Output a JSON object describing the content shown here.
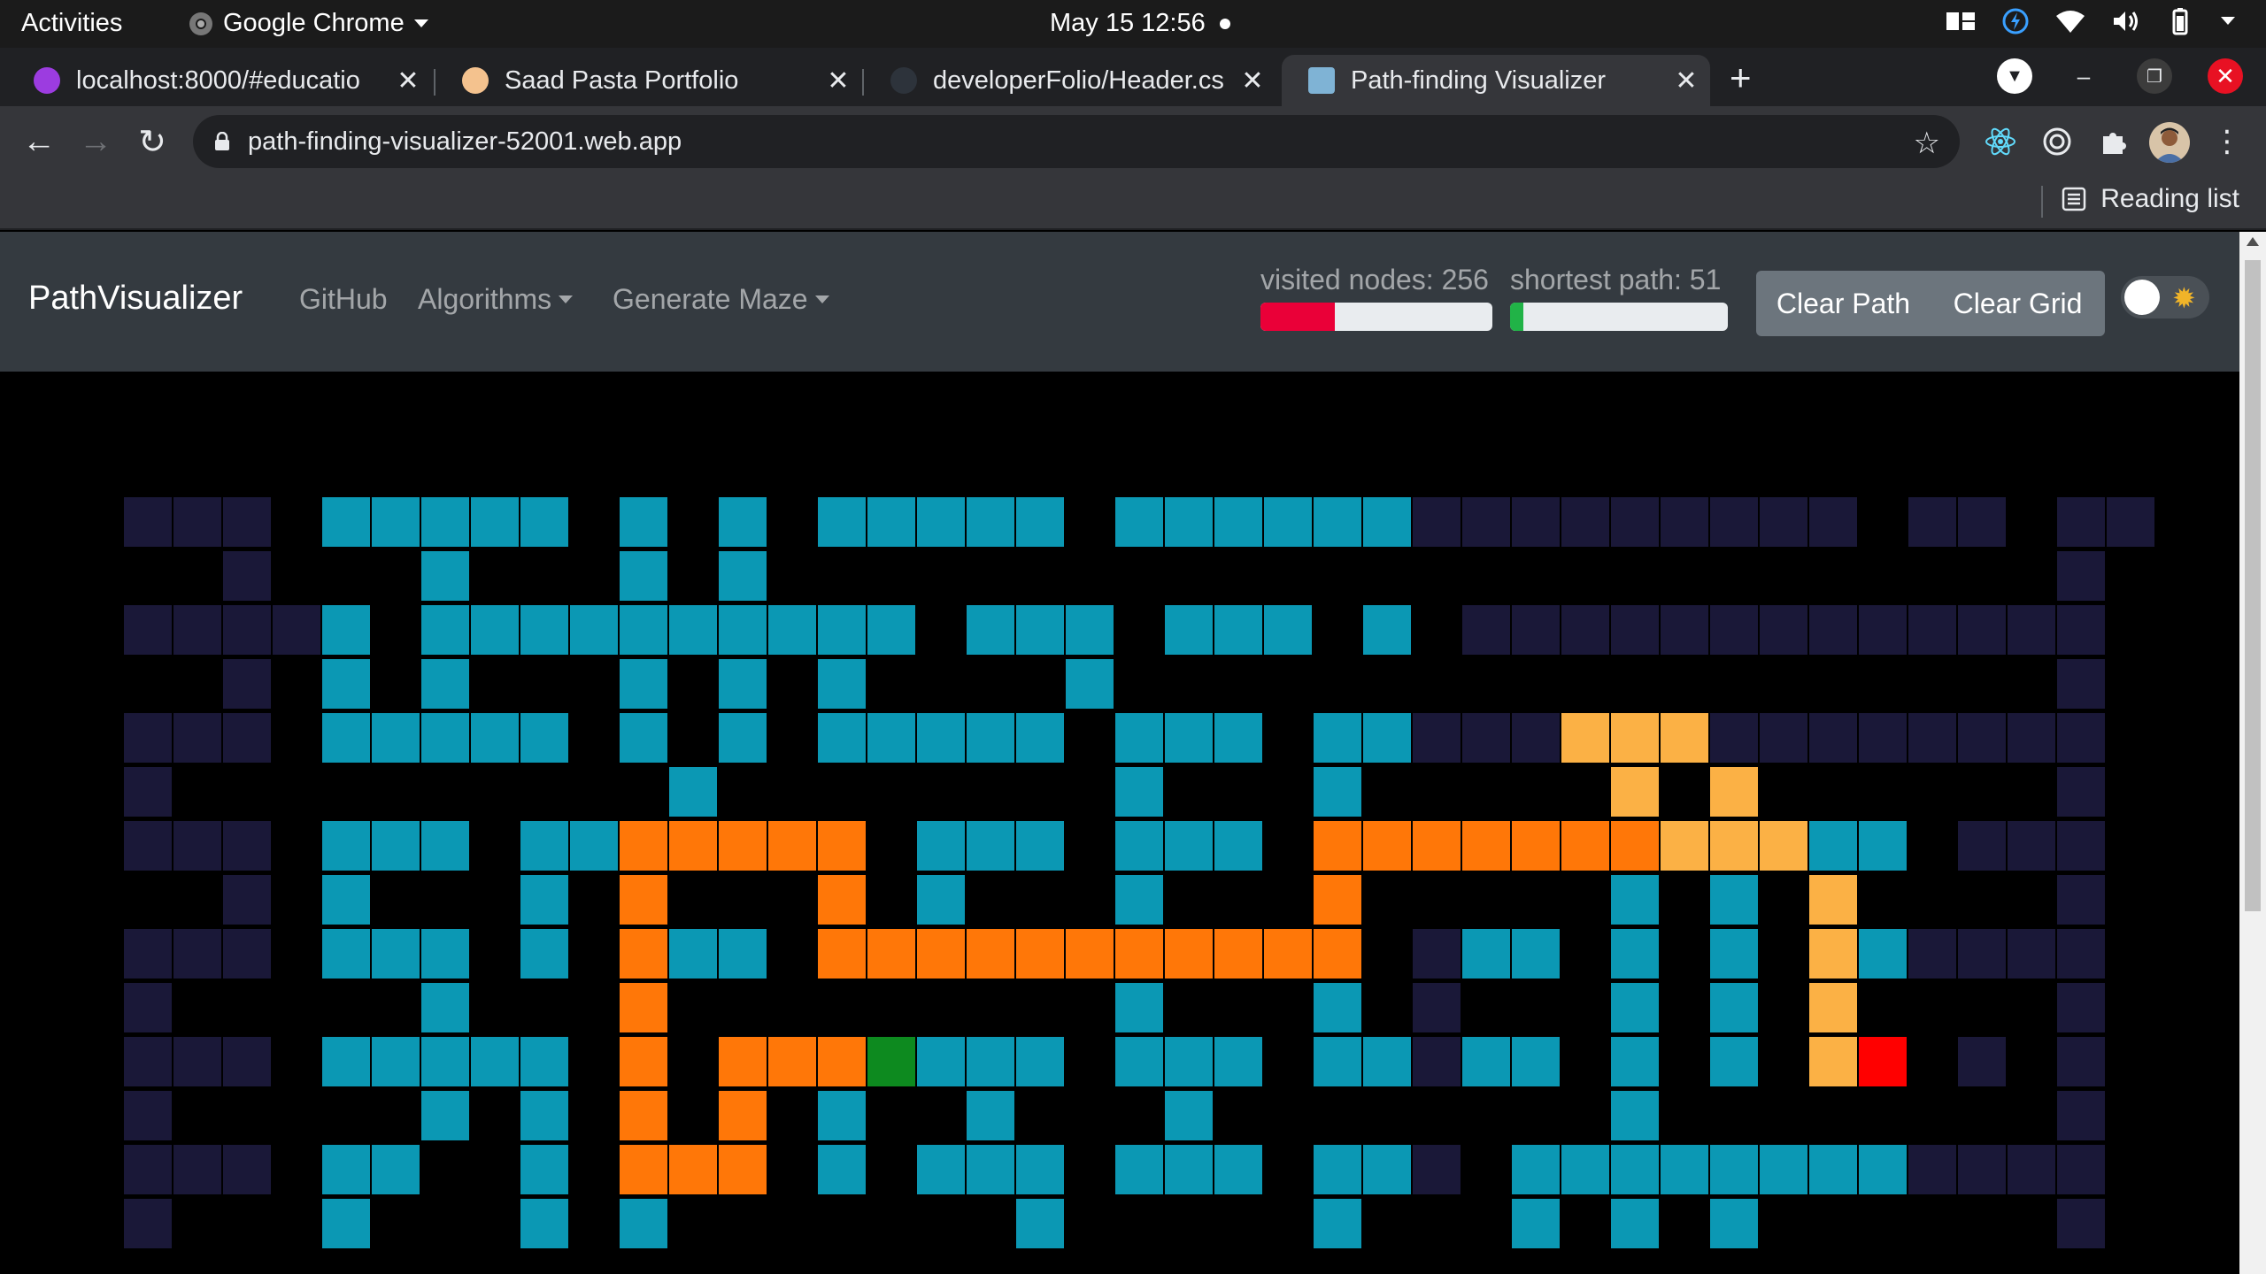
{
  "os": {
    "activities": "Activities",
    "app_name": "Google Chrome",
    "clock": "May 15  12:56"
  },
  "browser": {
    "tabs": [
      {
        "title": "localhost:8000/#educatio",
        "favicon_color": "#9c3ce0"
      },
      {
        "title": "Saad Pasta Portfolio",
        "favicon_color": "#f4c28e"
      },
      {
        "title": "developerFolio/Header.cs",
        "favicon_color": "#24292e"
      },
      {
        "title": "Path-finding Visualizer",
        "favicon_color": "#7fb3d5"
      }
    ],
    "new_tab": "+",
    "url": "path-finding-visualizer-52001.web.app",
    "reading_list": "Reading list"
  },
  "app": {
    "brand": "PathVisualizer",
    "nav": {
      "github": "GitHub",
      "algorithms": "Algorithms",
      "generate_maze": "Generate Maze"
    },
    "stats": {
      "visited_label": "visited nodes: 256",
      "shortest_label": "shortest path: 51",
      "visited_progress": 0.32,
      "shortest_progress": 0.06,
      "visited_color": "#ea0038",
      "shortest_color": "#21b347"
    },
    "buttons": {
      "clear_path": "Clear Path",
      "clear_grid": "Clear Grid"
    },
    "theme_toggle": {
      "state": "off",
      "icon": "sun-icon"
    }
  },
  "legend": {
    "wall": "#1a1838",
    "visited": "#0b98b4",
    "path": "#ff7708",
    "path_light": "#fbb145",
    "start": "#0d8a1f",
    "end": "#ff0000",
    "empty": "#000000"
  },
  "grid": {
    "rows": [
      "WWW.WWWWW.W.W.WWWWW.WWWWWWWWWWWWWWW.WW.WW",
      "..W...W...W.W..........................W",
      "WWWWW.WWWWWWWWWW.WWW.WWW.W.WWWWWWWWWWWWW",
      "..W.W.W...W.W.W....W...................W",
      "WWW.WWWWW.W.W.WWWWW.WWW.WWWWWLLLWWWWWWWW",
      "W..........W........W...W.....L.L......W",
      "WWW.WWW.WWPPPPP.WWW.WWW.PPPPPPPLLLWW.WWW",
      "..W.W...W.P...P.W...W...P.....W.W.L....W",
      "WWW.WWW.W.PWW.PPPPPPPPPPP.WWW.W.W.LWWWWW",
      "W.....W...P.........W...W.W...W.W.L....W",
      "WWW.WWWWW.P.PPPSWWW.WWW.WWWWW.W.W.LE.W.W",
      "W.....W.W.P.P.W..W...W........W........W",
      "WWW.WW..W.PPP.W.WWW.WWW.WWW.WWWWWWWWWWWW",
      "W...W...W.W.......W.....W...W.W.W......W"
    ]
  }
}
